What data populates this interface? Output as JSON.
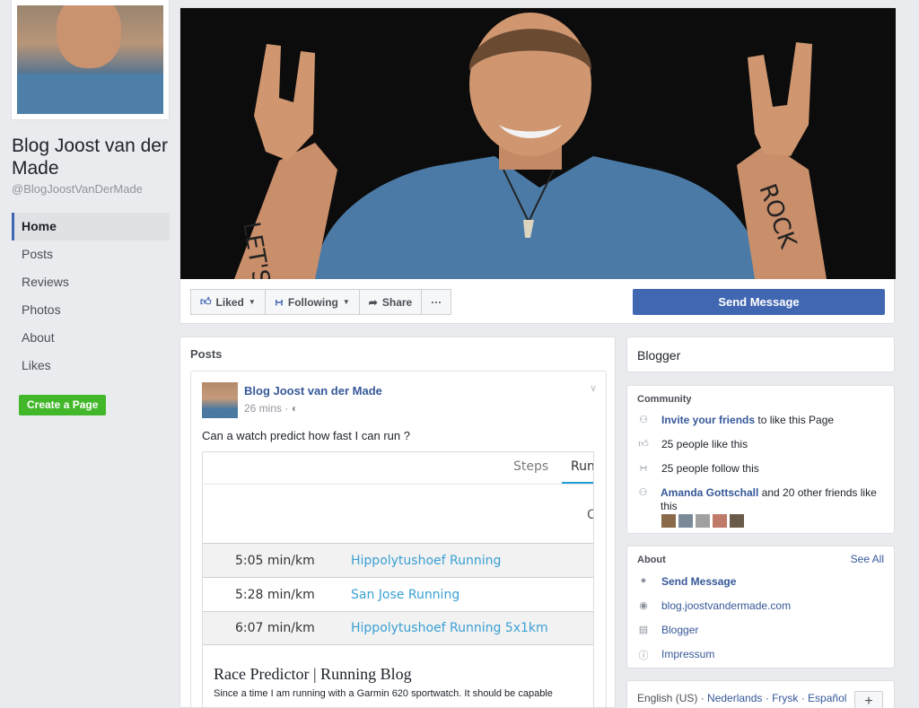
{
  "page": {
    "name": "Blog Joost van der Made",
    "handle": "@BlogJoostVanDerMade"
  },
  "nav": [
    {
      "label": "Home",
      "active": true
    },
    {
      "label": "Posts"
    },
    {
      "label": "Reviews"
    },
    {
      "label": "Photos"
    },
    {
      "label": "About"
    },
    {
      "label": "Likes"
    }
  ],
  "create_page_label": "Create a Page",
  "cover": {
    "left_arm_text": "LET'S",
    "right_arm_text": "ROCK"
  },
  "actions": {
    "liked": "Liked",
    "following": "Following",
    "share": "Share",
    "more": "···",
    "send_message": "Send Message"
  },
  "posts": {
    "title": "Posts",
    "author": "Blog Joost van der Made",
    "time": "26 mins · ",
    "text": "Can a watch predict how fast I can run ?",
    "tabs": [
      "Steps",
      "Run"
    ],
    "fragment": "C",
    "runs": [
      {
        "pace": "5:05 min/km",
        "name": "Hippolytushoef Running"
      },
      {
        "pace": "5:28 min/km",
        "name": "San Jose Running"
      },
      {
        "pace": "6:07 min/km",
        "name": "Hippolytushoef Running 5x1km"
      }
    ],
    "link_title": "Race Predictor | Running Blog",
    "link_desc": "Since a time I am running with a Garmin 620 sportwatch. It should be capable"
  },
  "category": "Blogger",
  "community": {
    "title": "Community",
    "invite_link": "Invite your friends",
    "invite_rest": " to like this Page",
    "likes": "25 people like this",
    "follows": "25 people follow this",
    "friend_link": "Amanda Gottschall",
    "friend_rest": " and 20 other friends like this"
  },
  "about": {
    "title": "About",
    "see_all": "See All",
    "send_message": "Send Message",
    "website": "blog.joostvandermade.com",
    "category": "Blogger",
    "impressum": "Impressum"
  },
  "languages": {
    "current": "English (US)",
    "others": "Nederlands · Frysk · Español",
    "plus": "+"
  },
  "colors": {
    "brand": "#4267b2",
    "link": "#365899",
    "green": "#42b72a",
    "run_link": "#3aa0d5"
  }
}
